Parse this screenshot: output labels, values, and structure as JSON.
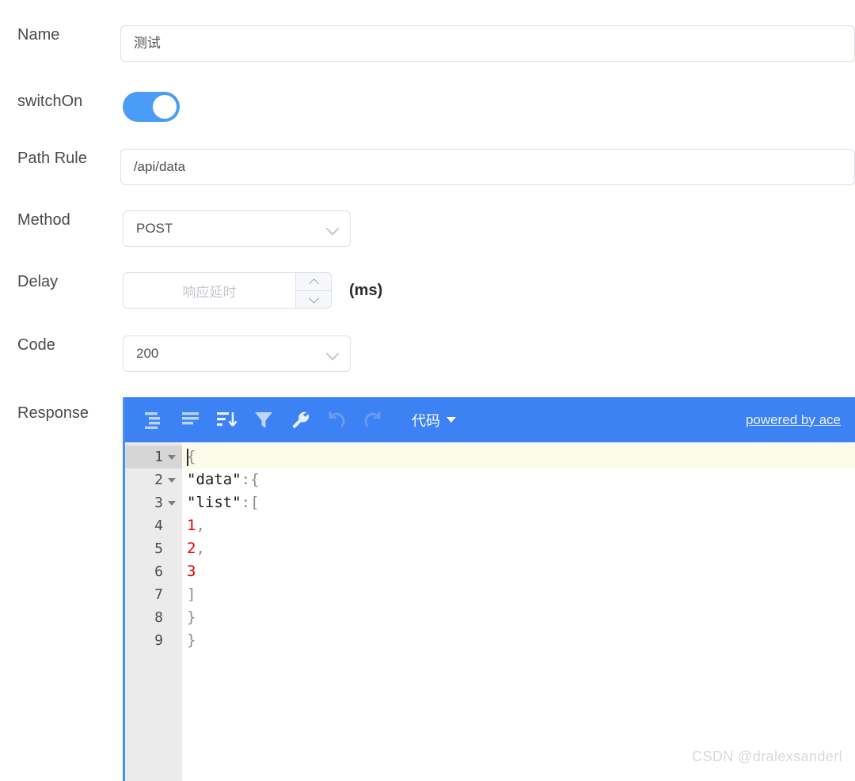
{
  "form": {
    "fields": [
      {
        "label": "Name",
        "value": "测试"
      },
      {
        "label": "switchOn"
      },
      {
        "label": "Path Rule",
        "value": "/api/data"
      },
      {
        "label": "Method",
        "value": "POST"
      },
      {
        "label": "Delay",
        "placeholder": "响应延时",
        "unit": "(ms)"
      },
      {
        "label": "Code",
        "value": "200"
      },
      {
        "label": "Response"
      }
    ]
  },
  "editor": {
    "toolbar": {
      "compact_icon": "compact-icon",
      "format_icon": "format-icon",
      "sort_icon": "sort-icon",
      "filter_icon": "filter-icon",
      "transform_icon": "wrench-icon",
      "undo_icon": "undo-icon",
      "redo_icon": "redo-icon",
      "mode_label": "代码",
      "ace_label": "powered by ace"
    },
    "lines": [
      {
        "num": "1",
        "fold": true,
        "active": true,
        "text": "{"
      },
      {
        "num": "2",
        "fold": true,
        "active": false,
        "text": "  \"data\": {"
      },
      {
        "num": "3",
        "fold": true,
        "active": false,
        "text": "    \"list\": ["
      },
      {
        "num": "4",
        "fold": false,
        "active": false,
        "text": "      1,"
      },
      {
        "num": "5",
        "fold": false,
        "active": false,
        "text": "      2,"
      },
      {
        "num": "6",
        "fold": false,
        "active": false,
        "text": "      3"
      },
      {
        "num": "7",
        "fold": false,
        "active": false,
        "text": "    ]"
      },
      {
        "num": "8",
        "fold": false,
        "active": false,
        "text": "  }"
      },
      {
        "num": "9",
        "fold": false,
        "active": false,
        "text": "}"
      }
    ]
  },
  "watermark": "CSDN @dralexsanderl",
  "colors": {
    "accent": "#3d82f5",
    "switch_on": "#4a9cf6",
    "number_token": "#e60000",
    "active_line": "#fcfae8"
  }
}
